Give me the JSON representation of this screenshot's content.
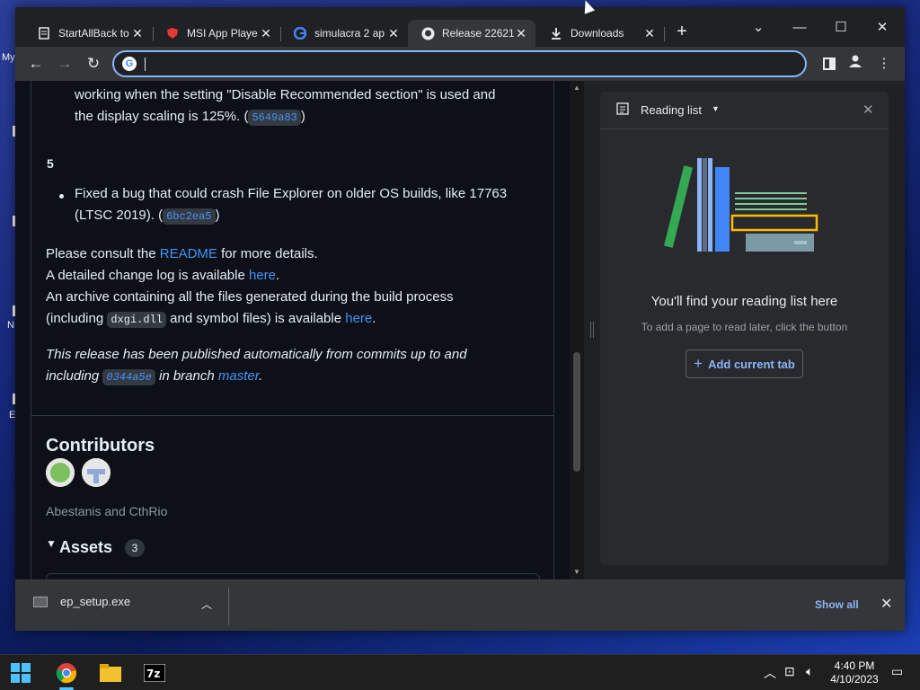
{
  "desktop": {
    "labels": [
      "My",
      "N",
      "E"
    ]
  },
  "tabs": [
    {
      "label": "StartAllBack to",
      "icon": "document-icon"
    },
    {
      "label": "MSI App Playe",
      "icon": "msi-shield-icon"
    },
    {
      "label": "simulacra 2 ap",
      "icon": "google-icon"
    },
    {
      "label": "Release 22621",
      "icon": "github-icon",
      "active": true
    },
    {
      "label": "Downloads",
      "icon": "download-icon"
    }
  ],
  "omnibox": {
    "value": "",
    "placeholder": ""
  },
  "article": {
    "para1_line1": "working when the setting \"Disable Recommended section\" is used and",
    "para1_line2_pre": "the display scaling is 125%. (",
    "para1_commit": "5649a83",
    "para1_post": ")",
    "section_number": "5",
    "bullet2_line1": "Fixed a bug that could crash File Explorer on older OS builds, like 17763",
    "bullet2_line2_pre": "(LTSC 2019). (",
    "bullet2_commit": "6bc2ea5",
    "bullet2_post": ")",
    "consult_pre": "Please consult the ",
    "consult_link": "README",
    "consult_post": " for more details.",
    "changelog_pre": "A detailed change log is available ",
    "changelog_link": "here",
    "changelog_post": ".",
    "archive_line1": "An archive containing all the files generated during the build process",
    "archive_pre": "(including ",
    "archive_code": "dxgi.dll",
    "archive_mid": " and symbol files) is available ",
    "archive_link": "here",
    "archive_post": ".",
    "auto_line1": "This release has been published automatically from commits up to and",
    "auto_pre": "including ",
    "auto_commit": "0344a5e",
    "auto_mid": " in branch ",
    "auto_branch": "master",
    "auto_post": "."
  },
  "contributors": {
    "heading": "Contributors",
    "names": "Abestanis and CthRio"
  },
  "assets": {
    "heading": "Assets",
    "count": "3"
  },
  "reading_list": {
    "title": "Reading list",
    "empty_heading": "You'll find your reading list here",
    "empty_sub": "To add a page to read later, click the button",
    "add_button": "Add current tab"
  },
  "downloads_bar": {
    "file_name": "ep_setup.exe",
    "show_all": "Show all"
  },
  "taskbar": {
    "time": "4:40 PM",
    "date": "4/10/2023"
  },
  "colors": {
    "accent": "#8ab4f8",
    "link": "#4493f8",
    "page_bg": "#0d1117"
  }
}
